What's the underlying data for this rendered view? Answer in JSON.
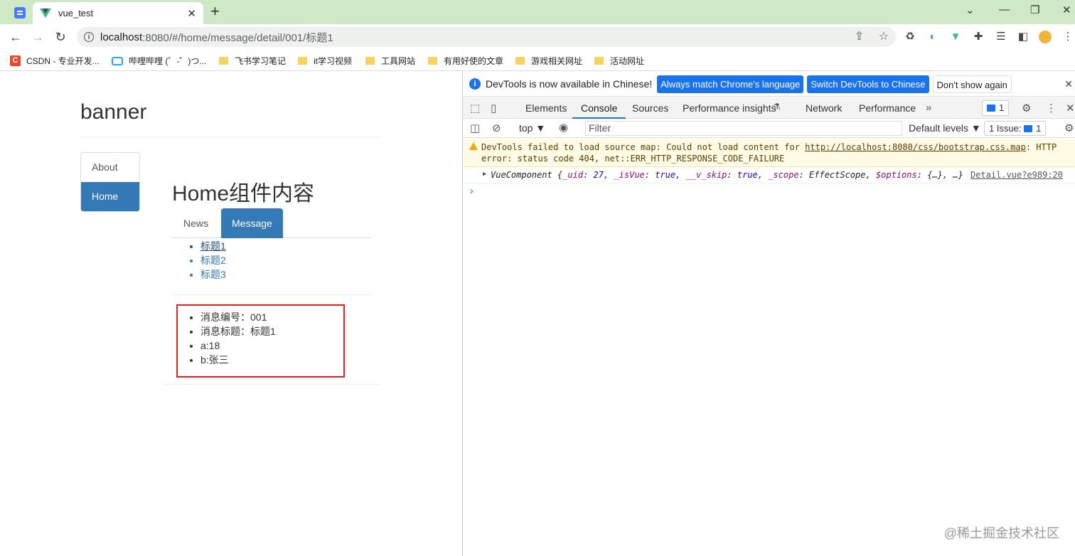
{
  "browser": {
    "tab_title": "vue_test",
    "url_host": "localhost",
    "url_path": ":8080/#/home/message/detail/001/标题1",
    "bookmarks": [
      {
        "label": "CSDN - 专业开发..."
      },
      {
        "label": "哔哩哔哩 (゜-゜)つ..."
      },
      {
        "label": "飞书学习笔记"
      },
      {
        "label": "it学习视频"
      },
      {
        "label": "工具网站"
      },
      {
        "label": "有用好使的文章"
      },
      {
        "label": "游戏相关网址"
      },
      {
        "label": "活动网址"
      }
    ]
  },
  "app": {
    "banner": "banner",
    "side_nav": [
      {
        "label": "About",
        "active": false
      },
      {
        "label": "Home",
        "active": true
      }
    ],
    "home_title": "Home组件内容",
    "tabs": [
      {
        "label": "News",
        "active": false
      },
      {
        "label": "Message",
        "active": true
      }
    ],
    "messages": [
      "标题1",
      "标题2",
      "标题3"
    ],
    "detail": {
      "id_line": "消息编号：001",
      "title_line": "消息标题：标题1",
      "a_line": "a:18",
      "b_line": "b:张三"
    }
  },
  "devtools": {
    "info_text": "DevTools is now available in Chinese!",
    "btn_match": "Always match Chrome's language",
    "btn_switch": "Switch DevTools to Chinese",
    "btn_dont_show": "Don't show again",
    "tabs": {
      "elements": "Elements",
      "console": "Console",
      "sources": "Sources",
      "perf_insights": "Performance insights",
      "network": "Network",
      "performance": "Performance"
    },
    "msg_count": "1",
    "context": "top",
    "filter_placeholder": "Filter",
    "levels": "Default levels",
    "issues_label": "1 Issue:",
    "issues_count": "1",
    "warning": {
      "prefix": "DevTools failed to load source map: Could not load content for ",
      "link": "http://localhost:8080/css/bootstrap.css.map",
      "suffix": ": HTTP error: status code 404, net::ERR_HTTP_RESPONSE_CODE_FAILURE"
    },
    "log": {
      "name": "VueComponent",
      "uid_key": "_uid",
      "uid_val": "27",
      "isvue_key": "_isVue",
      "isvue_val": "true",
      "vskip_key": "__v_skip",
      "vskip_val": "true",
      "scope_key": "_scope",
      "scope_val": "EffectScope",
      "options_key": "$options",
      "options_val": "{…}",
      "source": "Detail.vue?e989:20"
    }
  },
  "watermark": "@稀土掘金技术社区"
}
